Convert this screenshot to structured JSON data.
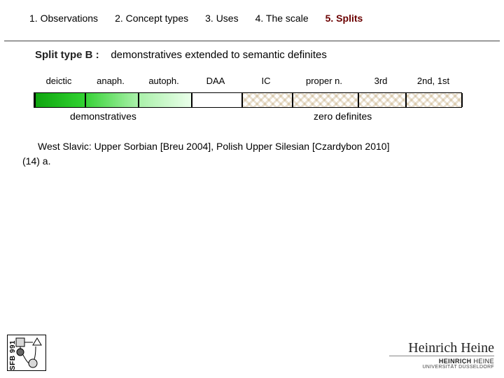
{
  "tabs": {
    "t1": "1. Observations",
    "t2": "2. Concept types",
    "t3": "3. Uses",
    "t4": "4. The scale",
    "t5": "5. Splits"
  },
  "heading": {
    "label": "Split type B :",
    "text": "demonstratives extended to semantic definites"
  },
  "cols": {
    "c0": "deictic",
    "c1": "anaph.",
    "c2": "autoph.",
    "c3": "DAA",
    "c4": "IC",
    "c5": "proper n.",
    "c6": "3rd",
    "c7": "2nd, 1st"
  },
  "ann": {
    "left": "demonstratives",
    "right": "zero definites"
  },
  "body": {
    "line1": "West Slavic: Upper Sorbian [Breu 2004], Polish Upper Silesian [Czardybon 2010]",
    "ex": "(14) a."
  },
  "footer": {
    "sfb": "SFB 991",
    "hhu_script": "Heinrich Heine",
    "hhu_name_bold": "HEINRICH",
    "hhu_name_rest": "HEINE",
    "hhu_sub": "UNIVERSITÄT DÜSSELDORF"
  }
}
